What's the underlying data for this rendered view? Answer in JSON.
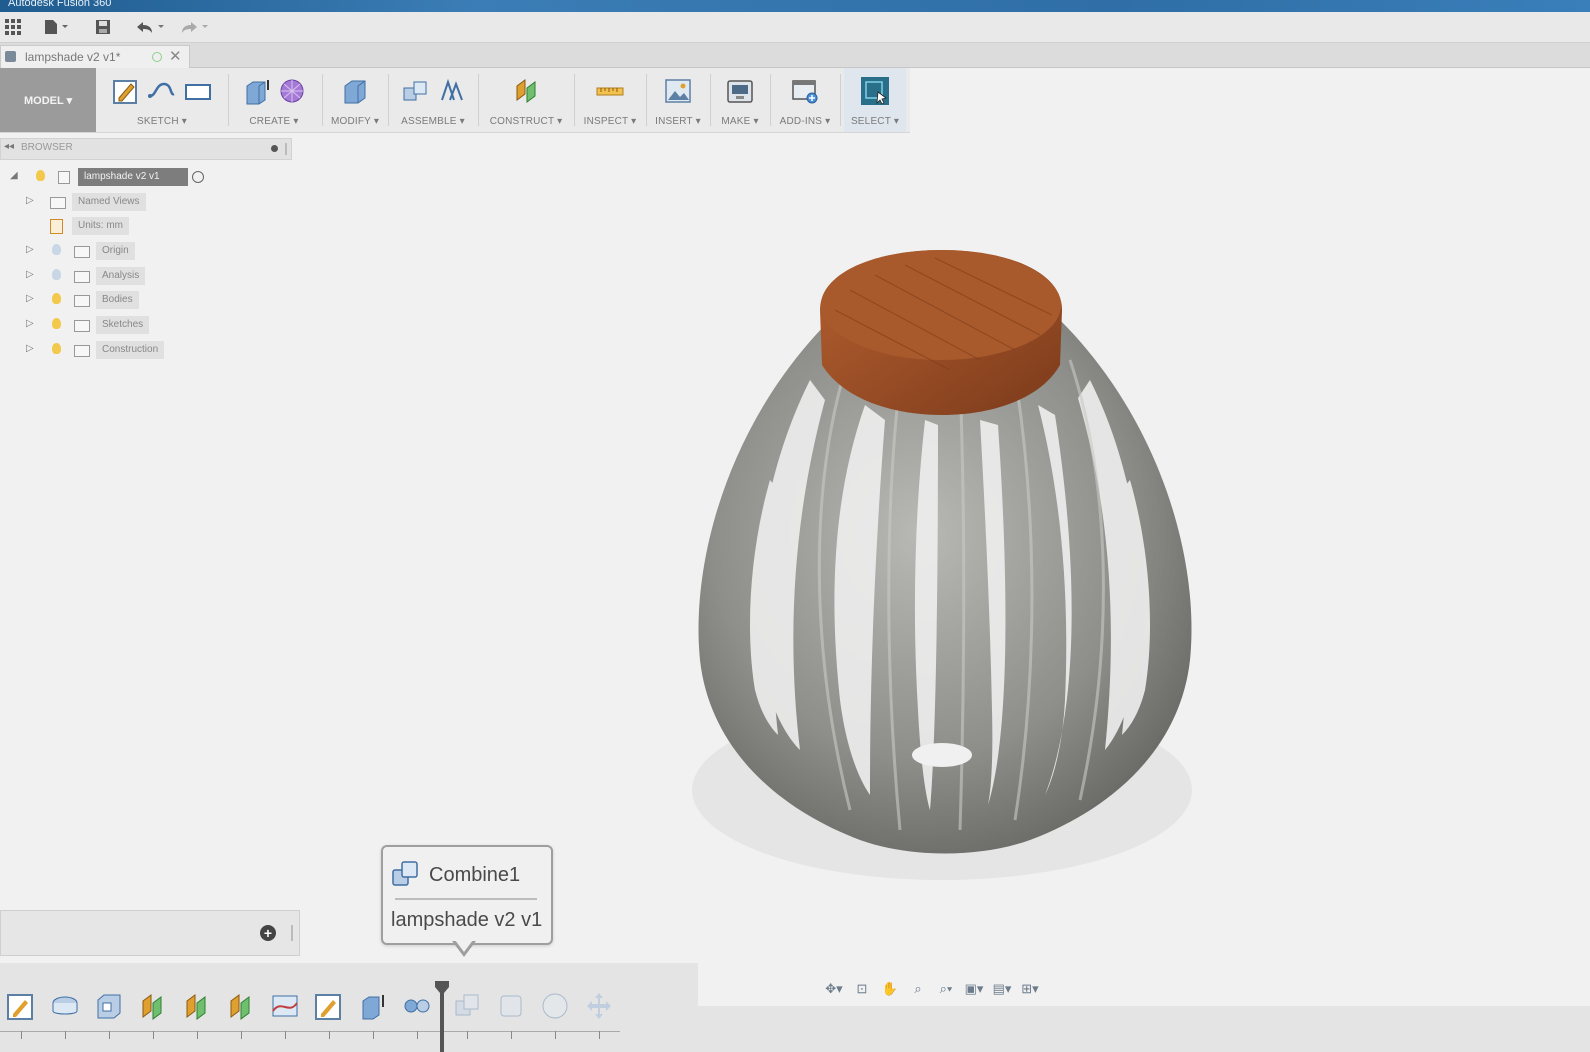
{
  "window": {
    "title": "Autodesk Fusion 360"
  },
  "document_tab": {
    "label": "lampshade v2 v1*",
    "close_glyph": "✕"
  },
  "ribbon": {
    "workspace": "MODEL ▾",
    "groups": [
      {
        "label": "SKETCH ▾"
      },
      {
        "label": "CREATE ▾"
      },
      {
        "label": "MODIFY ▾"
      },
      {
        "label": "ASSEMBLE ▾"
      },
      {
        "label": "CONSTRUCT ▾"
      },
      {
        "label": "INSPECT ▾"
      },
      {
        "label": "INSERT ▾"
      },
      {
        "label": "MAKE ▾"
      },
      {
        "label": "ADD-INS ▾"
      },
      {
        "label": "SELECT ▾"
      }
    ]
  },
  "browser": {
    "title": "BROWSER",
    "collapse_glyph": "◂◂",
    "root": "lampshade v2 v1",
    "items": [
      {
        "label": "Named Views"
      },
      {
        "label": "Units: mm"
      },
      {
        "label": "Origin"
      },
      {
        "label": "Analysis"
      },
      {
        "label": "Bodies"
      },
      {
        "label": "Sketches"
      },
      {
        "label": "Construction"
      }
    ]
  },
  "comments": {
    "add_glyph": "+"
  },
  "tooltip": {
    "feature": "Combine1",
    "component": "lampshade v2 v1"
  },
  "colors": {
    "wood": "#9a4e26",
    "lampshade": "#8a8a86",
    "select_accent": "#2a6f8a"
  }
}
